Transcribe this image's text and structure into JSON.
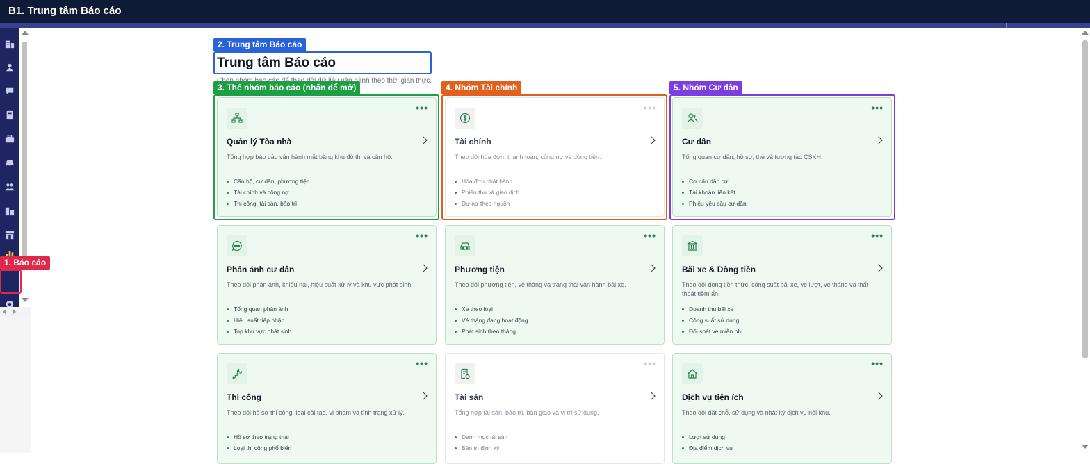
{
  "window": {
    "title": "B1. Trung tâm Báo cáo"
  },
  "annotations": {
    "a1": "1. Báo cáo",
    "a2": "2. Trung tâm Báo cáo",
    "a3": "3. Thẻ nhóm báo cáo (nhấn để mở)",
    "a4": "4. Nhóm Tài chính",
    "a5": "5. Nhóm Cư dân"
  },
  "colors": {
    "red": "#e0284a",
    "blue": "#2a63d9",
    "green": "#1e9e45",
    "orange": "#e2601d",
    "purple": "#7b3fe0"
  },
  "page": {
    "title": "Trung tâm Báo cáo",
    "subtitle": "Chọn nhóm báo cáo để theo dõi dữ liệu vận hành theo thời gian thực."
  },
  "sidebar": {
    "icons": [
      "building-icon",
      "user-pin-icon",
      "chat-icon",
      "calculator-icon",
      "briefcase-icon",
      "car-icon",
      "users-icon",
      "city-icon",
      "store-icon",
      "bar-chart-icon",
      "gear-icon"
    ]
  },
  "cards": [
    {
      "title": "Quản lý Tòa nhà",
      "desc": "Tổng hợp báo cáo vận hành mặt bằng khu đô thị và căn hộ.",
      "items": [
        "Căn hộ, cư dân, phương tiện",
        "Tài chính và công nợ",
        "Thi công, tài sản, bảo trì"
      ],
      "icon": "sitemap-icon"
    },
    {
      "title": "Tài chính",
      "desc": "Theo dõi hóa đơn, thanh toán, công nợ và dòng tiền.",
      "items": [
        "Hóa đơn phát hành",
        "Phiếu thu và giao dịch",
        "Dư nợ theo nguồn"
      ],
      "icon": "dollar-icon"
    },
    {
      "title": "Cư dân",
      "desc": "Tổng quan cư dân, hồ sơ, thẻ và tương tác CSKH.",
      "items": [
        "Cơ cấu dân cư",
        "Tài khoản liên kết",
        "Phiếu yêu cầu cư dân"
      ],
      "icon": "residents-icon"
    },
    {
      "title": "Phản ánh cư dân",
      "desc": "Theo dõi phản ánh, khiếu nại, hiệu suất xử lý và khu vực phát sinh.",
      "items": [
        "Tổng quan phản ánh",
        "Hiệu suất tiếp nhận",
        "Top khu vực phát sinh"
      ],
      "icon": "message-icon"
    },
    {
      "title": "Phương tiện",
      "desc": "Theo dõi phương tiện, vé tháng và trạng thái vận hành bãi xe.",
      "items": [
        "Xe theo loại",
        "Vé tháng đang hoạt động",
        "Phát sinh theo tháng"
      ],
      "icon": "car-icon"
    },
    {
      "title": "Bãi xe & Dòng tiền",
      "desc": "Theo dõi dòng tiền thực, công suất bãi xe, vé lượt, vé tháng và thất thoát tiềm ẩn.",
      "items": [
        "Doanh thu bãi xe",
        "Công suất sử dụng",
        "Đối soát vé miễn phí"
      ],
      "icon": "bank-icon"
    },
    {
      "title": "Thi công",
      "desc": "Theo dõi hồ sơ thi công, loại cải tạo, vi phạm và tình trạng xử lý.",
      "items": [
        "Hồ sơ theo trạng thái",
        "Loại thi công phổ biến"
      ],
      "icon": "wrench-icon"
    },
    {
      "title": "Tài sản",
      "desc": "Tổng hợp tài sản, bảo trì, bàn giao và vị trí sử dụng.",
      "items": [
        "Danh mục tài sản",
        "Bảo trì định kỳ"
      ],
      "icon": "asset-doc-icon"
    },
    {
      "title": "Dịch vụ tiện ích",
      "desc": "Theo dõi đặt chỗ, sử dụng và nhật ký dịch vụ nội khu.",
      "items": [
        "Lượt sử dụng",
        "Địa điểm dịch vụ"
      ],
      "icon": "home-icon"
    }
  ]
}
